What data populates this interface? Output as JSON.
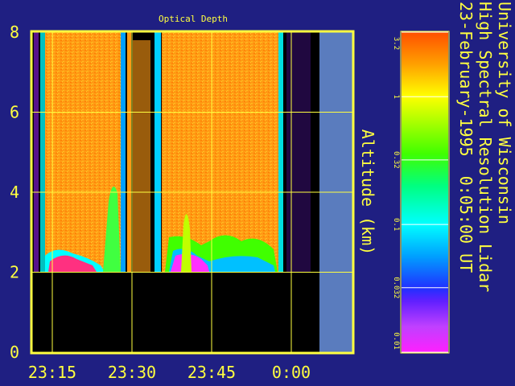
{
  "chart_data": {
    "type": "heatmap",
    "title": "Optical Depth",
    "ylabel": "Altitude (km)",
    "ylim": [
      0,
      8
    ],
    "y_ticks": [
      "0",
      "2",
      "4",
      "6",
      "8"
    ],
    "x_ticks": [
      "23:15",
      "23:30",
      "23:45",
      "0:00"
    ],
    "colorbar": {
      "scale": "log",
      "range": [
        0.01,
        3.2
      ],
      "tick_labels": [
        "3.2",
        "1",
        "0.32",
        "0.1",
        "0.032",
        "0.01"
      ]
    },
    "side_text": [
      "University of Wisconsin",
      "High Spectral Resolution Lidar",
      "23-February-1995  0:05:00 UT"
    ],
    "colors": {
      "background": "#1f1f82",
      "axis": "#ffff40",
      "no_data": "#5a7cbe",
      "below_range": "#000000"
    }
  }
}
